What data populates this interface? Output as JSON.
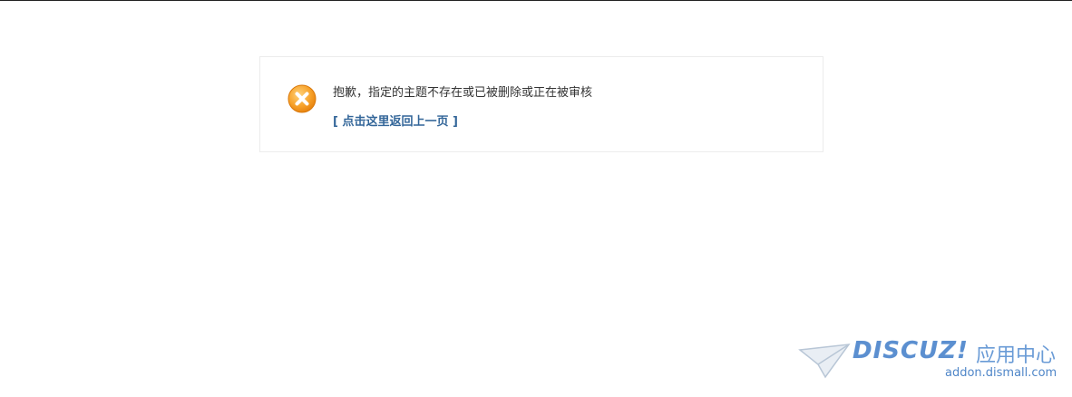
{
  "alert": {
    "icon": "error-x-icon",
    "message": "抱歉，指定的主题不存在或已被删除或正在被审核",
    "back_link": "[ 点击这里返回上一页 ]"
  },
  "watermark": {
    "icon": "paper-plane-icon",
    "brand": "DISCUZ!",
    "brand_cn": "应用中心",
    "url": "addon.dismall.com"
  },
  "colors": {
    "link": "#336699",
    "icon_orange": "#f39a1d",
    "watermark_blue": "#5b8fd0"
  }
}
